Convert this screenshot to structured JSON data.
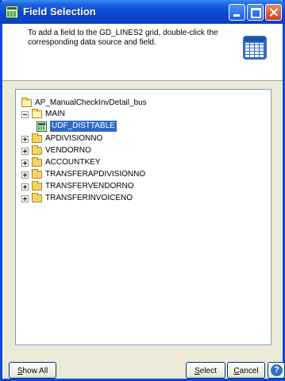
{
  "window": {
    "title": "Field Selection"
  },
  "header": {
    "instructions": "To add a field to the GD_LINES2 grid, double-click the corresponding data source and field."
  },
  "tree": {
    "root": {
      "label": "AP_ManualCheckInvDetail_bus"
    },
    "main": {
      "label": "MAIN"
    },
    "selected": {
      "label": "UDF_DISTTABLE"
    },
    "folders": [
      {
        "label": "APDIVISIONNO"
      },
      {
        "label": "VENDORNO"
      },
      {
        "label": "ACCOUNTKEY"
      },
      {
        "label": "TRANSFERAPDIVISIONNO"
      },
      {
        "label": "TRANSFERVENDORNO"
      },
      {
        "label": "TRANSFERINVOICENO"
      }
    ]
  },
  "buttons": {
    "show_all": {
      "mnemonic": "S",
      "rest": "how All"
    },
    "select": {
      "mnemonic": "S",
      "rest": "elect"
    },
    "cancel": {
      "mnemonic": "C",
      "rest": "ancel"
    },
    "help": "?"
  },
  "colors": {
    "selection": "#316ac5",
    "titlebar": "#0a4ad6",
    "dialog_bg": "#ece9d8"
  }
}
